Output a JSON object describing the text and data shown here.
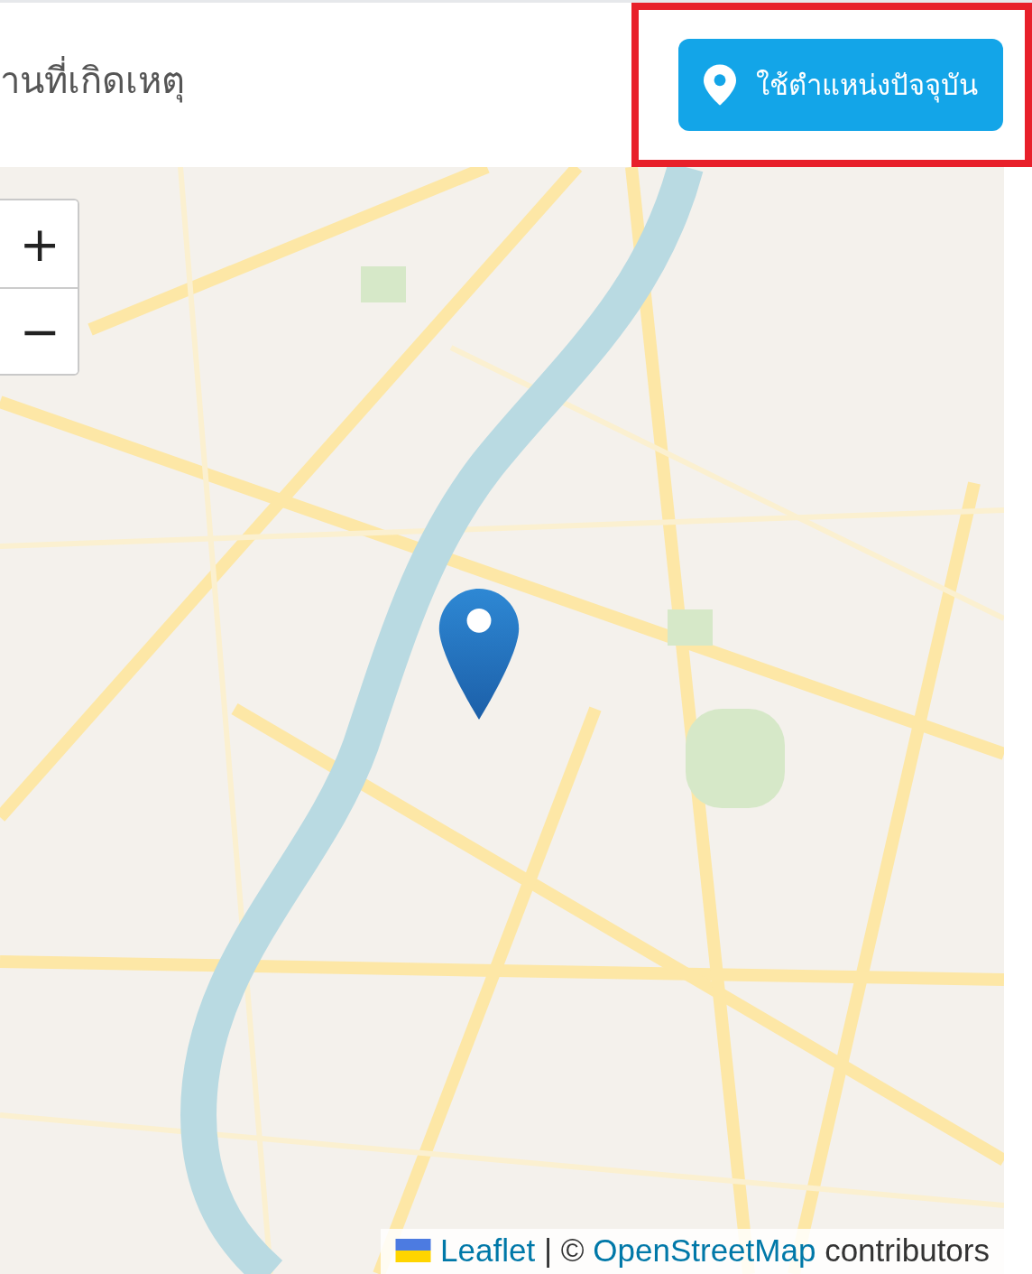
{
  "header": {
    "title": "านที่เกิดเหตุ",
    "location_button": {
      "label": "ใช้ตำแหน่งปัจจุบัน",
      "highlighted": true
    }
  },
  "map": {
    "zoom_controls": [
      "+",
      "−"
    ],
    "attribution": {
      "leaflet_link": "Leaflet",
      "separator": "|",
      "copyright": "©",
      "osm_link": "OpenStreetMap",
      "suffix": "contributors"
    }
  }
}
